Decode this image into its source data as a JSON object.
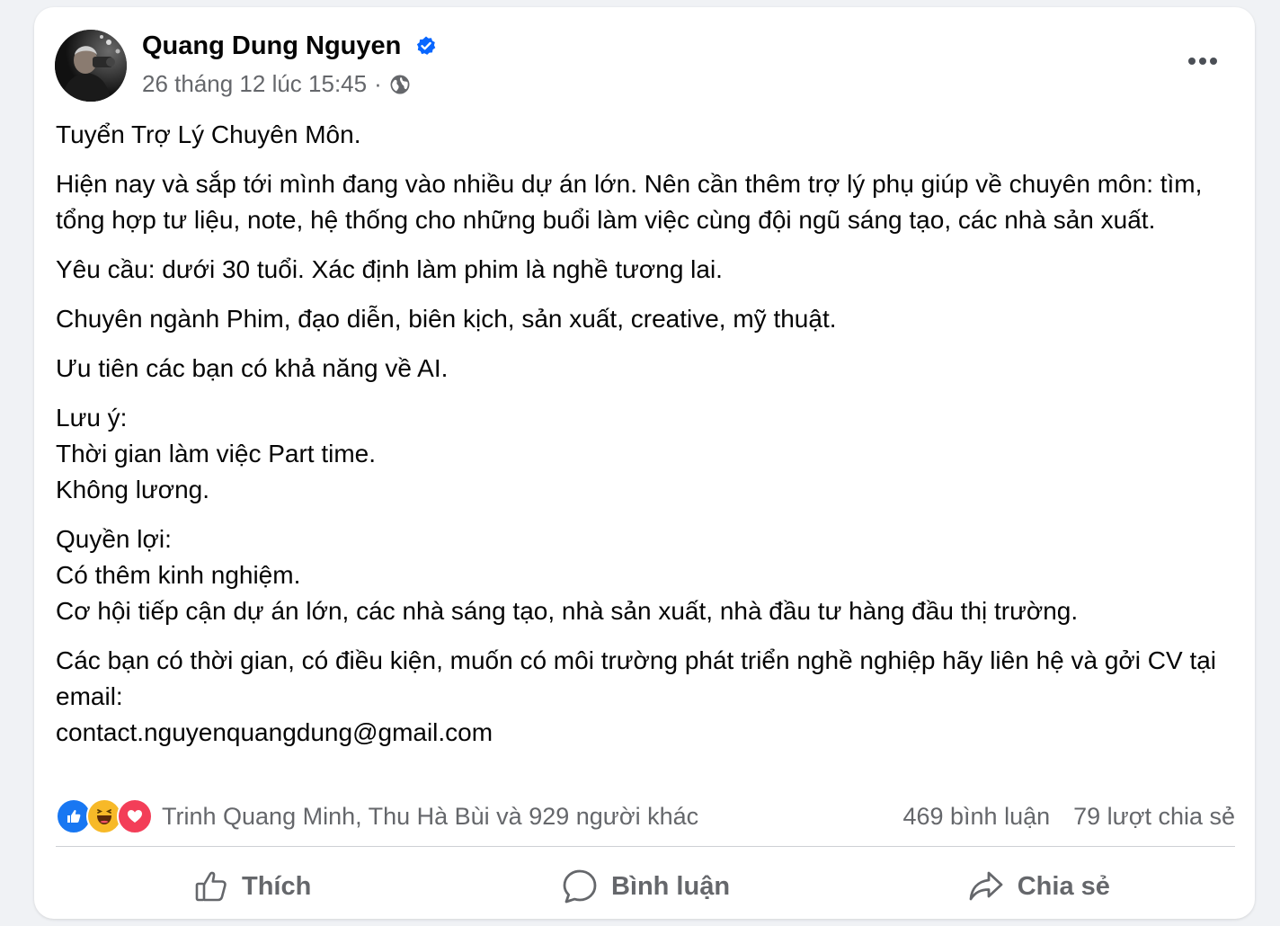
{
  "colors": {
    "accent": "#0866ff",
    "text": "#050505",
    "secondary_text": "#65676b",
    "like_blue": "#1877f2",
    "haha_yellow": "#f7b928",
    "love_red": "#f33e58"
  },
  "post": {
    "author": "Quang Dung Nguyen",
    "verified_icon": "verified-badge-icon",
    "timestamp": "26 tháng 12 lúc 15:45",
    "separator": "·",
    "audience_icon": "globe-icon",
    "more_icon": "more-horizontal-icon",
    "paragraphs": [
      [
        "Tuyển Trợ Lý Chuyên Môn."
      ],
      [
        "Hiện nay và sắp tới mình đang vào nhiều dự án lớn. Nên cần thêm trợ lý phụ giúp về chuyên môn: tìm, tổng hợp tư liệu, note, hệ thống cho những buổi làm việc cùng đội ngũ sáng tạo, các nhà sản xuất."
      ],
      [
        "Yêu cầu: dưới 30 tuổi. Xác định làm phim là nghề tương lai."
      ],
      [
        "Chuyên ngành Phim, đạo diễn, biên kịch, sản xuất, creative, mỹ thuật."
      ],
      [
        "Ưu tiên các bạn có khả năng về AI."
      ],
      [
        "Lưu ý:",
        "Thời gian làm việc Part time.",
        "Không lương."
      ],
      [
        "Quyền lợi:",
        "Có thêm kinh nghiệm.",
        "Cơ hội tiếp cận dự án lớn, các nhà sáng tạo, nhà sản xuất, nhà đầu tư hàng đầu thị trường."
      ],
      [
        "Các bạn có thời gian, có điều kiện, muốn có môi trường phát triển nghề nghiệp hãy liên hệ và gởi CV tại email:",
        "contact.nguyenquangdung@gmail.com"
      ]
    ]
  },
  "stats": {
    "reaction_icons": [
      "like-reaction-icon",
      "haha-reaction-icon",
      "love-reaction-icon"
    ],
    "reactors": "Trinh Quang Minh, Thu Hà Bùi và 929 người khác",
    "comments": "469 bình luận",
    "shares": "79 lượt chia sẻ"
  },
  "actions": {
    "like_label": "Thích",
    "comment_label": "Bình luận",
    "share_label": "Chia sẻ"
  }
}
